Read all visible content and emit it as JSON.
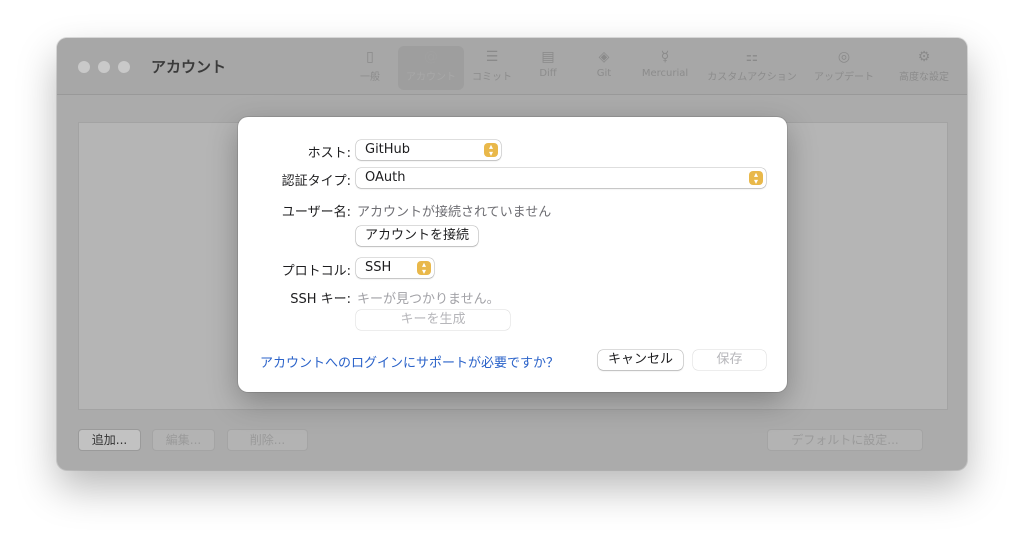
{
  "window": {
    "title": "アカウント",
    "toolbar": [
      {
        "label": "一般",
        "icon": "phone-icon",
        "glyph": "▯"
      },
      {
        "label": "アカウント",
        "icon": "at-icon",
        "glyph": "@"
      },
      {
        "label": "コミット",
        "icon": "list-icon",
        "glyph": "☰"
      },
      {
        "label": "Diff",
        "icon": "diff-icon",
        "glyph": "▤"
      },
      {
        "label": "Git",
        "icon": "git-icon",
        "glyph": "◈"
      },
      {
        "label": "Mercurial",
        "icon": "mercurial-icon",
        "glyph": "☿"
      },
      {
        "label": "カスタムアクション",
        "icon": "custom-action-icon",
        "glyph": "⚏"
      },
      {
        "label": "アップデート",
        "icon": "update-icon",
        "glyph": "◎"
      },
      {
        "label": "高度な設定",
        "icon": "gear-icon",
        "glyph": "⚙"
      }
    ],
    "bottom_buttons": {
      "add": "追加...",
      "edit": "編集...",
      "delete": "削除...",
      "set_default": "デフォルトに設定..."
    }
  },
  "sheet": {
    "host_label": "ホスト:",
    "host_value": "GitHub",
    "auth_type_label": "認証タイプ:",
    "auth_type_value": "OAuth",
    "username_label": "ユーザー名:",
    "username_value": "アカウントが接続されていません",
    "connect_button": "アカウントを接続",
    "protocol_label": "プロトコル:",
    "protocol_value": "SSH",
    "ssh_key_label": "SSH キー:",
    "ssh_key_value": "キーが見つかりません。",
    "generate_key_button": "キーを生成",
    "help_link": "アカウントへのログインにサポートが必要ですか？",
    "cancel_button": "キャンセル",
    "save_button": "保存"
  },
  "colors": {
    "popup_accent": "#e9b84a",
    "link": "#2a62c9"
  }
}
